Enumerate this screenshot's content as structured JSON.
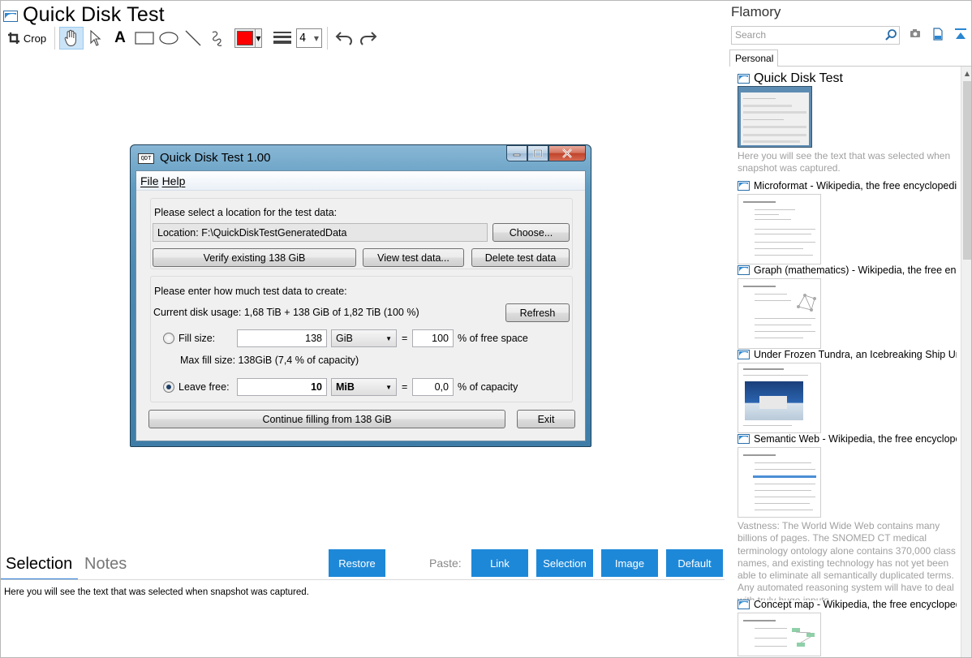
{
  "header": {
    "title": "Quick Disk Test"
  },
  "toolbar": {
    "crop_label": "Crop",
    "text_tool": "A",
    "line_width": "4",
    "current_color": "#ff0000"
  },
  "qdt": {
    "title": "Quick Disk Test 1.00",
    "icon_text": "QDT",
    "menu": [
      "File",
      "Help"
    ],
    "location_prompt": "Please select a location for the test data:",
    "location_value": "Location:  F:\\QuickDiskTestGeneratedData",
    "choose_label": "Choose...",
    "verify_label": "Verify existing 138 GiB",
    "view_label": "View test data...",
    "delete_label": "Delete test data",
    "amount_prompt": "Please enter how much test data to create:",
    "disk_usage": "Current disk usage: 1,68 TiB + 138 GiB of 1,82 TiB (100 %)",
    "refresh_label": "Refresh",
    "fill_size_label": "Fill size:",
    "fill_size_value": "138",
    "fill_size_unit": "GiB",
    "equals": "=",
    "fill_percent": "100",
    "fill_percent_label": "% of free space",
    "max_fill": "Max fill size: 138GiB (7,4 % of capacity)",
    "leave_free_label": "Leave free:",
    "leave_free_value": "10",
    "leave_free_unit": "MiB",
    "leave_percent": "0,0",
    "leave_percent_label": "% of capacity",
    "continue_label": "Continue filling from 138 GiB",
    "exit_label": "Exit"
  },
  "bottom": {
    "tabs": [
      "Selection",
      "Notes"
    ],
    "restore_label": "Restore",
    "paste_label": "Paste:",
    "paste_buttons": [
      "Link",
      "Selection",
      "Image",
      "Default"
    ],
    "selection_text": "Here you will see the text that was selected when snapshot was captured."
  },
  "sidebar": {
    "title": "Flamory",
    "search_placeholder": "Search",
    "tab": "Personal",
    "items": [
      {
        "title": "Quick Disk Test",
        "text": "Here you will see the text that was selected when snapshot was captured."
      },
      {
        "title": "Microformat - Wikipedia, the free encyclopedia",
        "text": ""
      },
      {
        "title": "Graph (mathematics) - Wikipedia, the free encyclopedia",
        "text": ""
      },
      {
        "title": "Under Frozen Tundra, an Icebreaking Ship Uncovers",
        "text": ""
      },
      {
        "title": "Semantic Web - Wikipedia, the free encyclopedia",
        "text": "Vastness: The World Wide Web contains many billions of pages. The SNOMED CT medical terminology ontology alone contains 370,000 class names, and existing technology has not yet been able to eliminate all semantically duplicated terms. Any automated reasoning system will have to deal with truly huge inputs."
      },
      {
        "title": "Concept map - Wikipedia, the free encyclopedia",
        "text": ""
      }
    ]
  },
  "colors": {
    "accent": "#1e88d8",
    "tab_underline": "#2a7bd3"
  }
}
